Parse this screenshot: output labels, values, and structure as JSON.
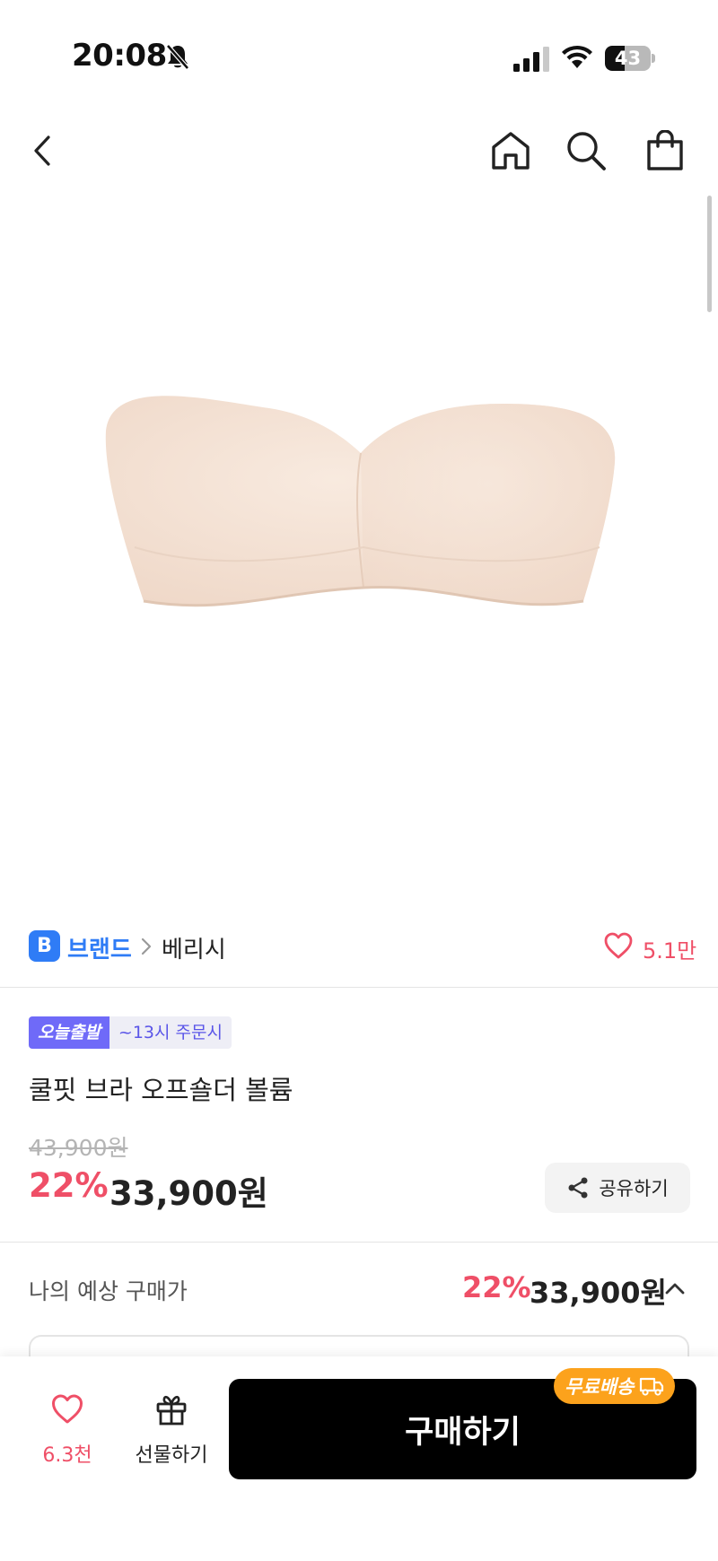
{
  "status_bar": {
    "time": "20:08",
    "battery": "43",
    "battery_level": 0.43
  },
  "icons": {
    "back": "chevron-left-icon",
    "home": "home-icon",
    "search": "search-icon",
    "cart": "shopping-bag-icon",
    "like": "heart-icon",
    "share": "share-icon",
    "gift": "gift-icon",
    "truck": "truck-icon"
  },
  "brand": {
    "badge": "B",
    "label": "브랜드",
    "name": "베리시",
    "like_count": "5.1만"
  },
  "product": {
    "tag_today": "오늘출발",
    "tag_order": "~13시 주문시",
    "name": "쿨핏 브라 오프숄더 볼륨",
    "original_price": "43,900원",
    "discount": "22%",
    "sale_price": "33,900원",
    "share_label": "공유하기"
  },
  "expected": {
    "label": "나의 예상 구매가",
    "discount": "22%",
    "price": "33,900원"
  },
  "bottom_bar": {
    "like_count": "6.3천",
    "gift_label": "선물하기",
    "buy_label": "구매하기",
    "free_shipping": "무료배송"
  },
  "colors": {
    "accent_pink": "#ef4f67",
    "brand_blue": "#2f7cf6",
    "tag_purple": "#6f6af8",
    "free_ship_orange": "#fca21c",
    "product_beige": "#f5e3d5"
  }
}
